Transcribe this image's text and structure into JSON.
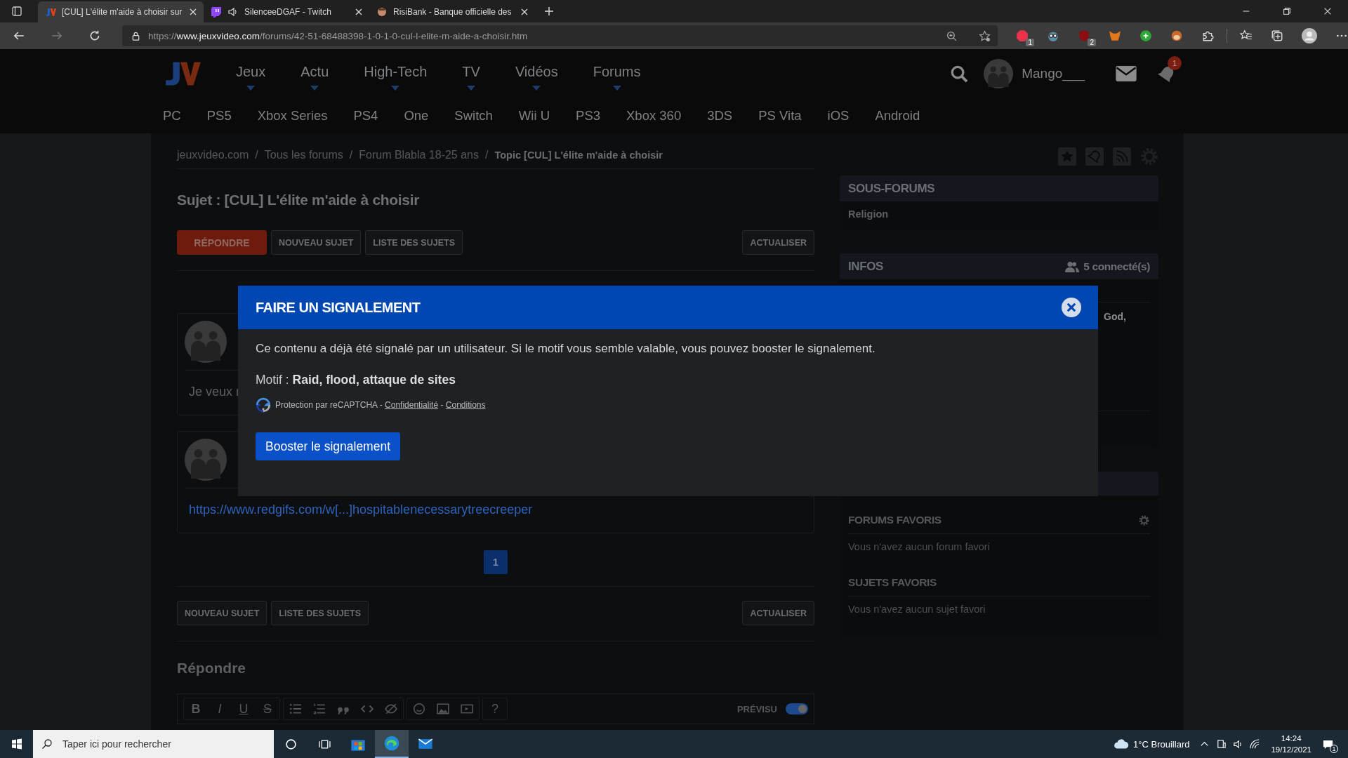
{
  "browser": {
    "tabs": [
      {
        "title": "[CUL] L'élite m'aide à choisir sur",
        "selected": true,
        "kind": "jv",
        "audio": false
      },
      {
        "title": "SilenceeDGAF - Twitch",
        "selected": false,
        "kind": "twitch",
        "audio": true
      },
      {
        "title": "RisiBank - Banque officielle des",
        "selected": false,
        "kind": "risibank",
        "audio": false
      }
    ],
    "url": {
      "scheme": "https://",
      "host": "www.jeuxvideo.com",
      "path": "/forums/42-51-68488398-1-0-1-0-cul-l-elite-m-aide-a-choisir.htm"
    },
    "extensions": [
      {
        "kind": "abp",
        "badge": "1"
      },
      {
        "kind": "glasses"
      },
      {
        "kind": "ublock",
        "badge": "2"
      },
      {
        "kind": "fox"
      },
      {
        "kind": "bplus"
      },
      {
        "kind": "monkey"
      },
      {
        "kind": "puzzle"
      }
    ]
  },
  "site": {
    "nav": [
      "Jeux",
      "Actu",
      "High-Tech",
      "TV",
      "Vidéos",
      "Forums"
    ],
    "user": "Mango___",
    "notifications": "1",
    "platforms": [
      "PC",
      "PS5",
      "Xbox Series",
      "PS4",
      "One",
      "Switch",
      "Wii U",
      "PS3",
      "Xbox 360",
      "3DS",
      "PS Vita",
      "iOS",
      "Android"
    ]
  },
  "breadcrumb": {
    "separator": "/",
    "items": [
      "jeuxvideo.com",
      "Tous les forums",
      "Forum Blabla 18-25 ans",
      "Topic [CUL] L'élite m'aide à choisir"
    ]
  },
  "subject": "Sujet : [CUL] L'élite m'aide à choisir",
  "top_actions": [
    {
      "label": "RÉPONDRE",
      "kind": "primary"
    },
    {
      "label": "NOUVEAU SUJET",
      "kind": "plain"
    },
    {
      "label": "LISTE DES SUJETS",
      "kind": "plain"
    },
    {
      "label": "ACTUALISER",
      "kind": "right"
    }
  ],
  "posts": [
    {
      "body": "Je veux r"
    },
    {
      "link": "https://www.redgifs.com/w[...]hospitablenecessarytreecreeper"
    }
  ],
  "pagination": [
    {
      "label": "1",
      "selected": true
    }
  ],
  "bottom_actions": [
    {
      "label": "NOUVEAU SUJET",
      "kind": "plain"
    },
    {
      "label": "LISTE DES SUJETS",
      "kind": "plain"
    },
    {
      "label": "ACTUALISER",
      "kind": "right"
    }
  ],
  "reply": {
    "heading": "Répondre",
    "preview_label": "PRÉVISU",
    "preview_on": true,
    "tool_groups": [
      [
        {
          "kind": "bold",
          "label": "B"
        },
        {
          "kind": "italic",
          "label": "I"
        },
        {
          "kind": "underline",
          "label": "U"
        },
        {
          "kind": "strike",
          "label": "S"
        }
      ],
      [
        {
          "kind": "bullets"
        },
        {
          "kind": "numbers"
        },
        {
          "kind": "quote"
        },
        {
          "kind": "code"
        },
        {
          "kind": "spoiler"
        }
      ],
      [
        {
          "kind": "emoji"
        },
        {
          "kind": "image"
        },
        {
          "kind": "video"
        }
      ],
      [
        {
          "kind": "help",
          "label": "?"
        }
      ]
    ]
  },
  "sidebar": {
    "sous_forums": {
      "title": "SOUS-FORUMS",
      "items": [
        "Religion"
      ]
    },
    "infos": {
      "title": "INFOS",
      "connected": "5 connecté(s)",
      "fragment": "God,"
    },
    "forums_favoris": {
      "title": "FORUMS FAVORIS",
      "empty": "Vous n'avez aucun forum favori"
    },
    "sujets_favoris": {
      "title": "SUJETS FAVORIS",
      "empty": "Vous n'avez aucun sujet favori"
    }
  },
  "modal": {
    "title": "FAIRE UN SIGNALEMENT",
    "message": "Ce contenu a déjà été signalé par un utilisateur. Si le motif vous semble valable, vous pouvez booster le signalement.",
    "motif": "Motif : **Raid, flood, attaque de sites**",
    "captcha": {
      "text": "Protection par reCAPTCHA -",
      "privacy": "Confidentialité",
      "separator": "-",
      "terms": "Conditions"
    },
    "button": "Booster le signalement"
  },
  "taskbar": {
    "search_placeholder": "Taper ici pour rechercher",
    "apps": [
      {
        "kind": "cortana",
        "selected": false
      },
      {
        "kind": "taskview",
        "selected": false
      },
      {
        "kind": "store",
        "selected": false
      },
      {
        "kind": "edge",
        "selected": true
      },
      {
        "kind": "mail",
        "selected": false
      }
    ],
    "weather": "1°C Brouillard",
    "time": "14:24",
    "date": "19/12/2021",
    "notification_count": "1"
  }
}
